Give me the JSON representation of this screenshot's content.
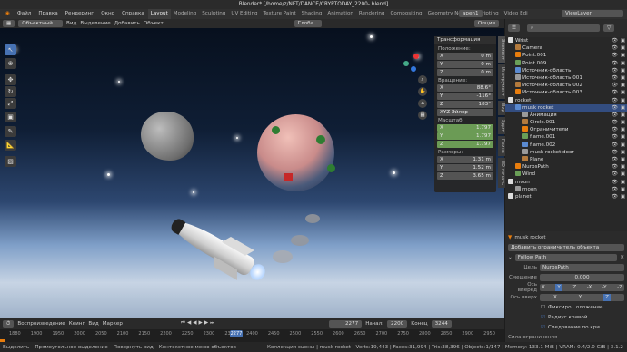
{
  "title": "Blender* [/home/z/NFT/DANCE/CRYPTODAY_2200-.blend]",
  "menu": [
    "Файл",
    "Правка",
    "Рендеринг",
    "Окно",
    "Справка"
  ],
  "workspaces": [
    "Layout",
    "Modeling",
    "Sculpting",
    "UV Editing",
    "Texture Paint",
    "Shading",
    "Animation",
    "Rendering",
    "Compositing",
    "Geometry Nodes",
    "Scripting",
    "Video Edi"
  ],
  "scene": "apen1",
  "viewlayer": "ViewLayer",
  "vp_header": {
    "mode": "Объектный ...",
    "menus": [
      "Вид",
      "Выделение",
      "Добавить",
      "Объект"
    ],
    "orient": "Глоба...",
    "options": "Опции"
  },
  "npanel": {
    "title": "Трансформация",
    "loc_label": "Положение:",
    "loc": [
      [
        "X",
        "0 m"
      ],
      [
        "Y",
        "0 m"
      ],
      [
        "Z",
        "0 m"
      ]
    ],
    "rot_label": "Вращение:",
    "rot": [
      [
        "X",
        "88.6°"
      ],
      [
        "Y",
        "-116°"
      ],
      [
        "Z",
        "183°"
      ]
    ],
    "rot_mode": "XYZ Эйлер",
    "scale_label": "Масштаб:",
    "scale": [
      [
        "X",
        "1.797"
      ],
      [
        "Y",
        "1.797"
      ],
      [
        "Z",
        "1.797"
      ]
    ],
    "dim_label": "Размеры:",
    "dim": [
      [
        "X",
        "1.31 m"
      ],
      [
        "Y",
        "1.52 m"
      ],
      [
        "Z",
        "3.65 m"
      ]
    ]
  },
  "sidetabs": [
    "Элемент",
    "Инструмент",
    "Вид",
    "Эдит",
    "Гринв",
    "3D-печать"
  ],
  "timeline": {
    "menus": [
      "Воспроизведение",
      "Кеинг",
      "Вид",
      "Маркер"
    ],
    "frame": "2277",
    "start_label": "Начал:",
    "start": "2200",
    "end_label": "Конец",
    "end": "3244",
    "ticks": [
      "1880",
      "1900",
      "1950",
      "2000",
      "2050",
      "2100",
      "2150",
      "2200",
      "2250",
      "2300",
      "2350",
      "2400",
      "2450",
      "2500",
      "2550",
      "2600",
      "2650",
      "2700",
      "2750",
      "2800",
      "2850",
      "2900",
      "2950"
    ],
    "cursor": "2277"
  },
  "status": [
    "Выделить",
    "Прямоугольное выделение",
    "Повернуть вид",
    "Контекстное меню объектов",
    "Коллекция сцены | musk rocket | Verts:19,443 | Faces:31,994 | Tris:38,396 | Objects:1/147 | Memory: 133.1 MiB | VRAM: 0.4/2.0 GiB | 3.1.2"
  ],
  "outliner": [
    {
      "t": "Wrist",
      "d": 0
    },
    {
      "t": "Camera",
      "d": 1
    },
    {
      "t": "Point.001",
      "d": 1
    },
    {
      "t": "Point.009",
      "d": 1
    },
    {
      "t": "Источник-область",
      "d": 1
    },
    {
      "t": "Источник-область.001",
      "d": 1
    },
    {
      "t": "Источник-область.002",
      "d": 1
    },
    {
      "t": "Источник-область.003",
      "d": 1
    },
    {
      "t": "rocket",
      "d": 0
    },
    {
      "t": "musk rocket",
      "d": 1,
      "sel": true
    },
    {
      "t": "Анимация",
      "d": 2
    },
    {
      "t": "Circle.001",
      "d": 2
    },
    {
      "t": "Ограничители",
      "d": 2
    },
    {
      "t": "flame.001",
      "d": 2
    },
    {
      "t": "flame.002",
      "d": 2
    },
    {
      "t": "musk rocket door",
      "d": 2
    },
    {
      "t": "Plane",
      "d": 2
    },
    {
      "t": "NurbsPath",
      "d": 1
    },
    {
      "t": "Wind",
      "d": 1
    },
    {
      "t": "moon",
      "d": 0
    },
    {
      "t": "moon",
      "d": 1
    },
    {
      "t": "planet",
      "d": 0
    }
  ],
  "props": {
    "object": "musk rocket",
    "add_constraint": "Добавить ограничитель объекта",
    "constraint": "Follow Path",
    "target_label": "Цель",
    "target": "NurbsPath",
    "offset_label": "Смещение",
    "offset": "0.000",
    "fwd_label": "Ось вперёд",
    "fwd": [
      "X",
      "Y",
      "Z",
      "-X",
      "-Y",
      "-Z"
    ],
    "up_label": "Ось вверх",
    "up": [
      "X",
      "Y",
      "Z"
    ],
    "checks": [
      "Фиксиро...оложение",
      "Радиус кривой",
      "Следование по кри..."
    ],
    "influence_label": "Сила ограничения"
  }
}
